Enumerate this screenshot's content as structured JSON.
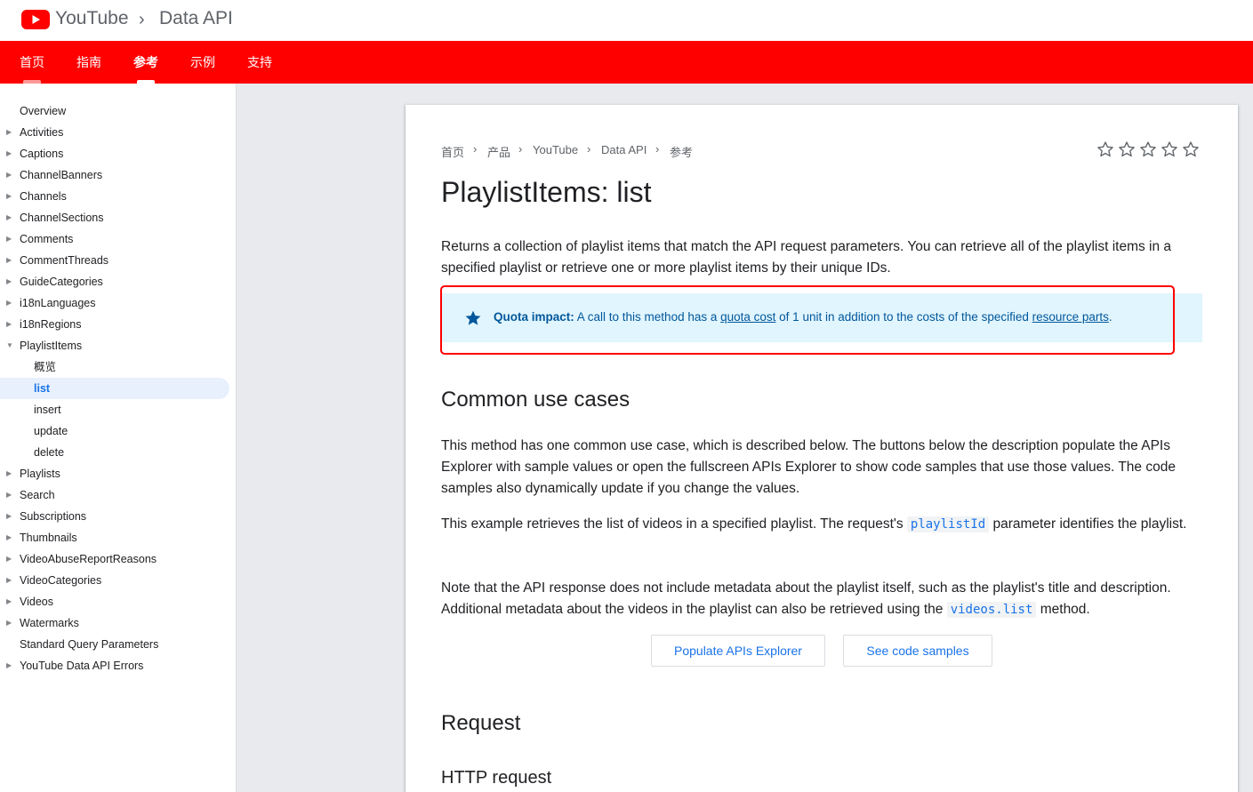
{
  "header": {
    "brand": "YouTube",
    "separator": "›",
    "product": "Data API"
  },
  "nav": {
    "tabs": [
      "首页",
      "指南",
      "参考",
      "示例",
      "支持"
    ],
    "active": "参考"
  },
  "sidebar": {
    "items": [
      {
        "label": "Overview"
      },
      {
        "label": "Activities"
      },
      {
        "label": "Captions"
      },
      {
        "label": "ChannelBanners"
      },
      {
        "label": "Channels"
      },
      {
        "label": "ChannelSections"
      },
      {
        "label": "Comments"
      },
      {
        "label": "CommentThreads"
      },
      {
        "label": "GuideCategories"
      },
      {
        "label": "i18nLanguages"
      },
      {
        "label": "i18nRegions"
      },
      {
        "label": "PlaylistItems"
      },
      {
        "label": "概览"
      },
      {
        "label": "list"
      },
      {
        "label": "insert"
      },
      {
        "label": "update"
      },
      {
        "label": "delete"
      },
      {
        "label": "Playlists"
      },
      {
        "label": "Search"
      },
      {
        "label": "Subscriptions"
      },
      {
        "label": "Thumbnails"
      },
      {
        "label": "VideoAbuseReportReasons"
      },
      {
        "label": "VideoCategories"
      },
      {
        "label": "Videos"
      },
      {
        "label": "Watermarks"
      },
      {
        "label": "Standard Query Parameters"
      },
      {
        "label": "YouTube Data API Errors"
      }
    ]
  },
  "breadcrumb": [
    "首页",
    "产品",
    "YouTube",
    "Data API",
    "参考"
  ],
  "rating": {
    "stars": 5,
    "filled": 0
  },
  "page": {
    "title": "PlaylistItems: list",
    "intro": "Returns a collection of playlist items that match the API request parameters. You can retrieve all of the playlist items in a specified playlist or retrieve one or more playlist items by their unique IDs.",
    "quota": {
      "label": "Quota impact:",
      "text1": " A call to this method has a ",
      "link1": "quota cost",
      "text2": " of 1 unit in addition to the costs of the specified ",
      "link2": "resource parts",
      "text3": "."
    },
    "h_common": "Common use cases",
    "p_common": "This method has one common use case, which is described below. The buttons below the description populate the APIs Explorer with sample values or open the fullscreen APIs Explorer to show code samples that use those values. The code samples also dynamically update if you change the values.",
    "p_example_a": "This example retrieves the list of videos in a specified playlist. The request's ",
    "p_example_code": "playlistId",
    "p_example_b": " parameter identifies the playlist.",
    "p_note_a": "Note that the API response does not include metadata about the playlist itself, such as the playlist's title and description. Additional metadata about the videos in the playlist can also be retrieved using the ",
    "p_note_code": "videos.list",
    "p_note_b": " method.",
    "btn_populate": "Populate APIs Explorer",
    "btn_samples": "See code samples",
    "h_request": "Request",
    "h_http": "HTTP request"
  },
  "colors": {
    "brand_red": "#ff0000",
    "link_blue": "#1a73e8",
    "quota_bg": "#e1f5fe",
    "quota_text": "#01579b"
  }
}
